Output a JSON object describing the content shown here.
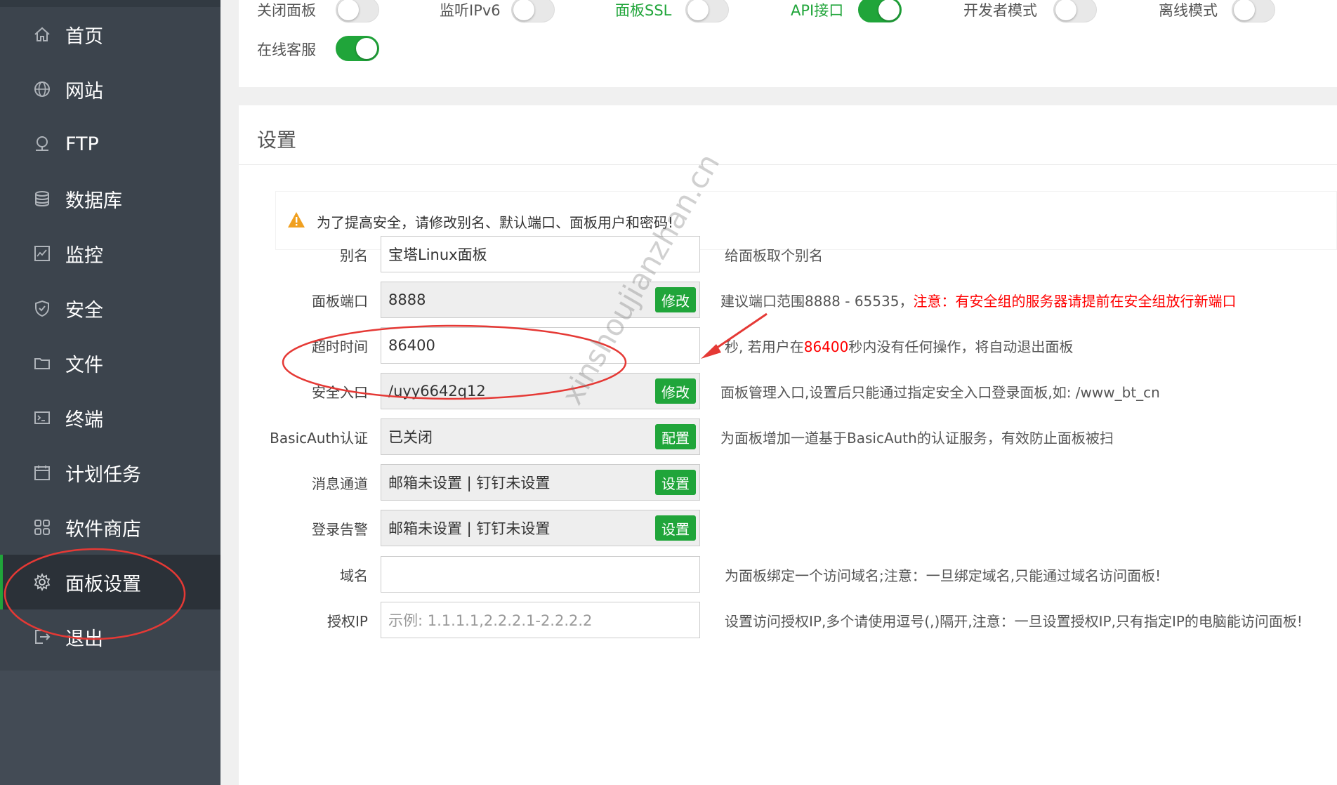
{
  "sidebar": {
    "items": [
      {
        "label": "首页",
        "icon": "home-icon"
      },
      {
        "label": "网站",
        "icon": "globe-icon"
      },
      {
        "label": "FTP",
        "icon": "ftp-icon"
      },
      {
        "label": "数据库",
        "icon": "database-icon"
      },
      {
        "label": "监控",
        "icon": "monitor-icon"
      },
      {
        "label": "安全",
        "icon": "shield-icon"
      },
      {
        "label": "文件",
        "icon": "folder-icon"
      },
      {
        "label": "终端",
        "icon": "terminal-icon"
      },
      {
        "label": "计划任务",
        "icon": "calendar-icon"
      },
      {
        "label": "软件商店",
        "icon": "apps-icon"
      },
      {
        "label": "面板设置",
        "icon": "gear-icon",
        "active": true
      },
      {
        "label": "退出",
        "icon": "logout-icon"
      }
    ]
  },
  "toggles": [
    {
      "label": "关闭面板",
      "on": false
    },
    {
      "label": "监听IPv6",
      "on": false
    },
    {
      "label": "面板SSL",
      "on": false
    },
    {
      "label": "API接口",
      "on": true
    },
    {
      "label": "开发者模式",
      "on": false
    },
    {
      "label": "离线模式",
      "on": false
    },
    {
      "label": "在线客服",
      "on": true
    }
  ],
  "settings": {
    "title": "设置",
    "alert": "为了提高安全，请修改别名、默认端口、面板用户和密码!",
    "rows": {
      "alias": {
        "label": "别名",
        "value": "宝塔Linux面板",
        "hint": "给面板取个别名"
      },
      "port": {
        "label": "面板端口",
        "value": "8888",
        "button": "修改",
        "hint_normal": "建议端口范围8888 - 65535，",
        "hint_red": "注意：有安全组的服务器请提前在安全组放行新端口"
      },
      "timeout": {
        "label": "超时时间",
        "value": "86400",
        "hint_before": "秒, 若用户在",
        "hint_red": "86400",
        "hint_after": "秒内没有任何操作，将自动退出面板"
      },
      "entry": {
        "label": "安全入口",
        "value": "/uyy6642q12",
        "button": "修改",
        "hint": "面板管理入口,设置后只能通过指定安全入口登录面板,如: /www_bt_cn"
      },
      "basicauth": {
        "label": "BasicAuth认证",
        "value": "已关闭",
        "button": "配置",
        "hint": "为面板增加一道基于BasicAuth的认证服务，有效防止面板被扫"
      },
      "message": {
        "label": "消息通道",
        "value": "邮箱未设置 | 钉钉未设置",
        "button": "设置"
      },
      "login_alert": {
        "label": "登录告警",
        "value": "邮箱未设置 | 钉钉未设置",
        "button": "设置"
      },
      "domain": {
        "label": "域名",
        "value": "",
        "hint": "为面板绑定一个访问域名;注意：一旦绑定域名,只能通过域名访问面板!"
      },
      "auth_ip": {
        "label": "授权IP",
        "placeholder": "示例: 1.1.1.1,2.2.2.1-2.2.2.2",
        "hint": "设置访问授权IP,多个请使用逗号(,)隔开,注意：一旦设置授权IP,只有指定IP的电脑能访问面板!"
      }
    }
  },
  "watermark": "xinshoujianzhan.cn",
  "colors": {
    "accent": "#20a53a",
    "annotation": "#e53935",
    "sidebar": "#3c444d"
  }
}
